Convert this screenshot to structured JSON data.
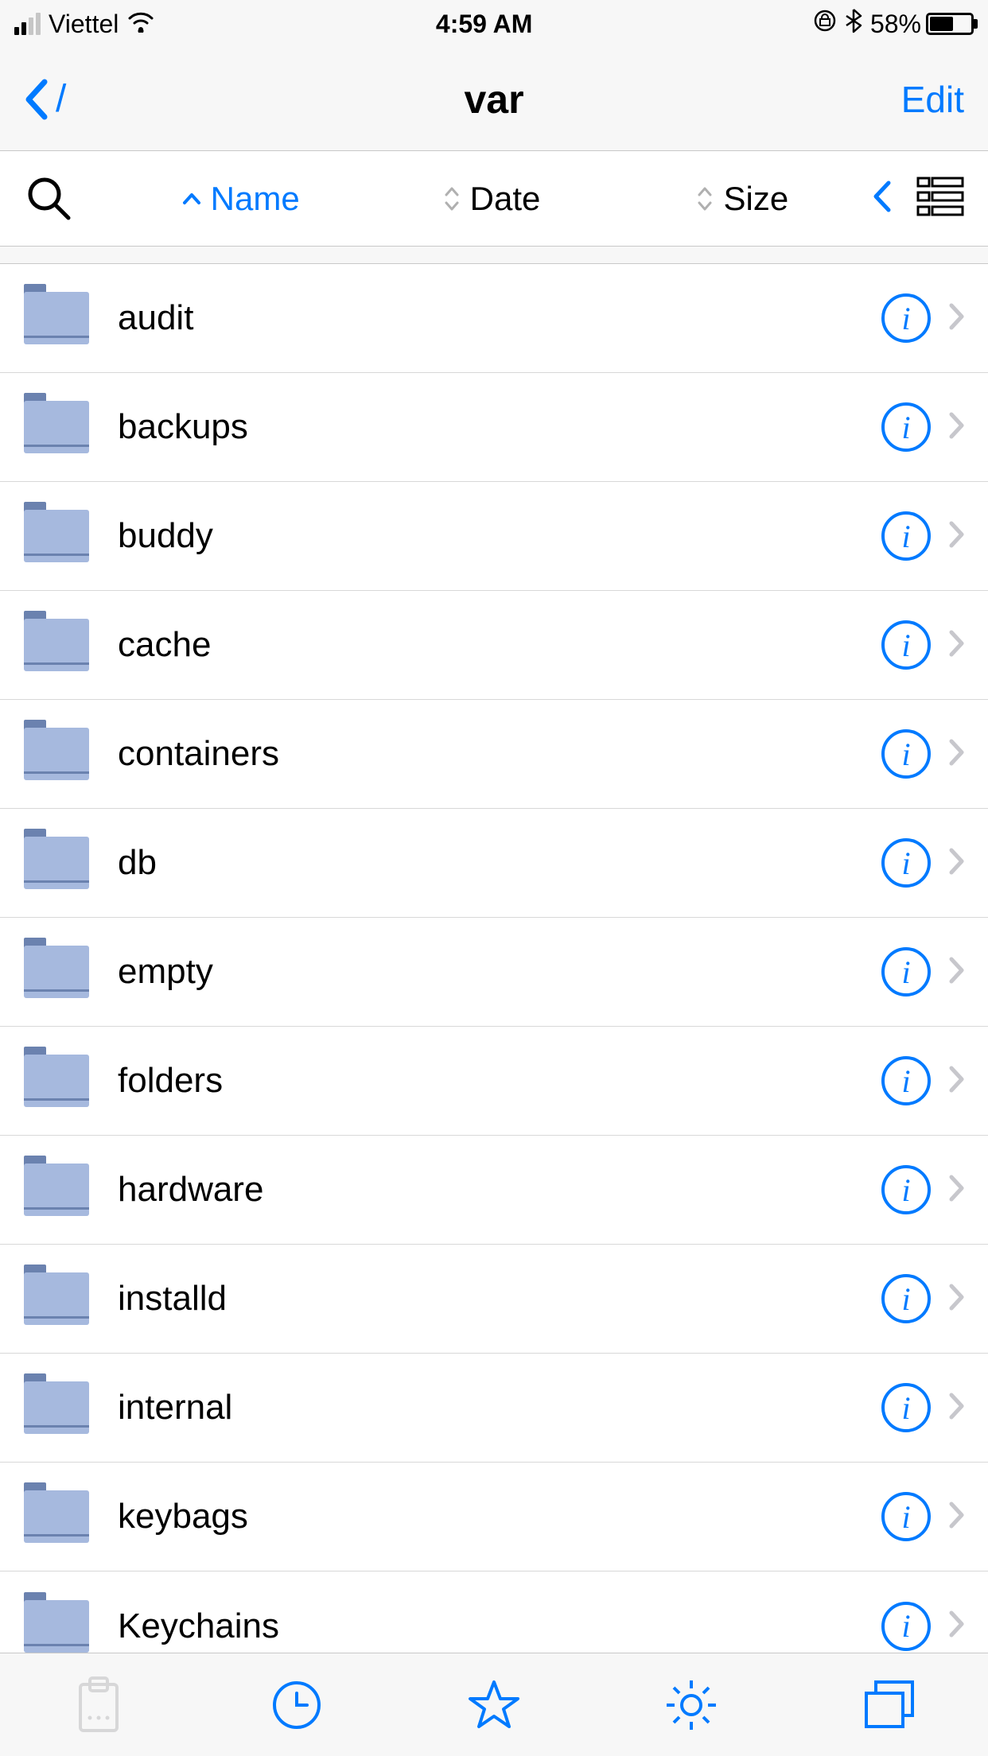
{
  "status": {
    "carrier": "Viettel",
    "time": "4:59 AM",
    "battery_pct": "58%",
    "battery_level": 58
  },
  "nav": {
    "back_label": "/",
    "title": "var",
    "edit_label": "Edit"
  },
  "sort": {
    "name_label": "Name",
    "date_label": "Date",
    "size_label": "Size",
    "active": "name"
  },
  "files": [
    {
      "name": "audit"
    },
    {
      "name": "backups"
    },
    {
      "name": "buddy"
    },
    {
      "name": "cache"
    },
    {
      "name": "containers"
    },
    {
      "name": "db"
    },
    {
      "name": "empty"
    },
    {
      "name": "folders"
    },
    {
      "name": "hardware"
    },
    {
      "name": "installd"
    },
    {
      "name": "internal"
    },
    {
      "name": "keybags"
    },
    {
      "name": "Keychains"
    }
  ],
  "colors": {
    "accent": "#007aff",
    "folder_light": "#a6b9de",
    "folder_dark": "#6b82af"
  }
}
